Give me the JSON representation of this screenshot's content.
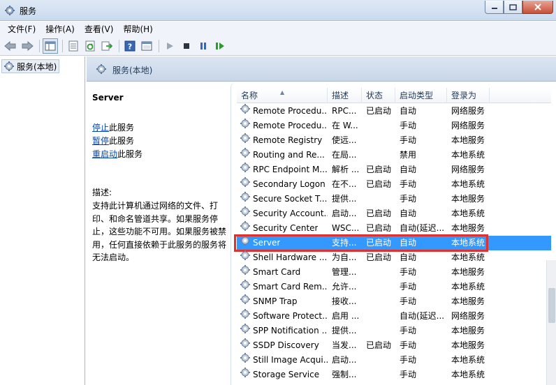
{
  "window": {
    "title": "服务"
  },
  "menu": [
    "文件(F)",
    "操作(A)",
    "查看(V)",
    "帮助(H)"
  ],
  "tree": {
    "root_label": "服务(本地)"
  },
  "header": {
    "title": "服务(本地)"
  },
  "details": {
    "service_name": "Server",
    "actions": [
      {
        "link": "停止",
        "suffix": "此服务"
      },
      {
        "link": "暂停",
        "suffix": "此服务"
      },
      {
        "link": "重启动",
        "suffix": "此服务"
      }
    ],
    "description_label": "描述:",
    "description": "支持此计算机通过网络的文件、打印、和命名管道共享。如果服务停止，这些功能不可用。如果服务被禁用，任何直接依赖于此服务的服务将无法启动。"
  },
  "columns": [
    "名称",
    "描述",
    "状态",
    "启动类型",
    "登录为"
  ],
  "services": [
    {
      "name": "Remote Procedu...",
      "desc": "RPC...",
      "status": "已启动",
      "startup": "自动",
      "logon": "网络服务"
    },
    {
      "name": "Remote Procedu...",
      "desc": "在 W...",
      "status": "",
      "startup": "手动",
      "logon": "网络服务"
    },
    {
      "name": "Remote Registry",
      "desc": "使远...",
      "status": "",
      "startup": "手动",
      "logon": "本地服务"
    },
    {
      "name": "Routing and Re...",
      "desc": "在局...",
      "status": "",
      "startup": "禁用",
      "logon": "本地系统"
    },
    {
      "name": "RPC Endpoint M...",
      "desc": "解析 ...",
      "status": "已启动",
      "startup": "自动",
      "logon": "网络服务"
    },
    {
      "name": "Secondary Logon",
      "desc": "在不...",
      "status": "已启动",
      "startup": "手动",
      "logon": "本地系统"
    },
    {
      "name": "Secure Socket T...",
      "desc": "提供...",
      "status": "",
      "startup": "手动",
      "logon": "本地服务"
    },
    {
      "name": "Security Account...",
      "desc": "启动...",
      "status": "已启动",
      "startup": "自动",
      "logon": "本地系统"
    },
    {
      "name": "Security Center",
      "desc": "WSC...",
      "status": "已启动",
      "startup": "自动(延迟...",
      "logon": "本地服务"
    },
    {
      "name": "Server",
      "desc": "支持...",
      "status": "已启动",
      "startup": "自动",
      "logon": "本地系统"
    },
    {
      "name": "Shell Hardware ...",
      "desc": "为自...",
      "status": "已启动",
      "startup": "自动",
      "logon": "本地系统"
    },
    {
      "name": "Smart Card",
      "desc": "管理...",
      "status": "",
      "startup": "手动",
      "logon": "本地服务"
    },
    {
      "name": "Smart Card Rem...",
      "desc": "允许...",
      "status": "",
      "startup": "手动",
      "logon": "本地系统"
    },
    {
      "name": "SNMP Trap",
      "desc": "接收...",
      "status": "",
      "startup": "手动",
      "logon": "本地服务"
    },
    {
      "name": "Software Protect...",
      "desc": "启用 ...",
      "status": "",
      "startup": "自动(延迟...",
      "logon": "网络服务"
    },
    {
      "name": "SPP Notification ...",
      "desc": "提供...",
      "status": "",
      "startup": "手动",
      "logon": "本地服务"
    },
    {
      "name": "SSDP Discovery",
      "desc": "当发...",
      "status": "已启动",
      "startup": "手动",
      "logon": "本地服务"
    },
    {
      "name": "Still Image Acqui...",
      "desc": "启动...",
      "status": "",
      "startup": "手动",
      "logon": "本地系统"
    },
    {
      "name": "Storage Service",
      "desc": "强制...",
      "status": "",
      "startup": "手动",
      "logon": "本地系统"
    }
  ],
  "selected_index": 9,
  "colors": {
    "selection": "#3399ff",
    "highlight_border": "#e0312f",
    "link": "#0645ad"
  }
}
